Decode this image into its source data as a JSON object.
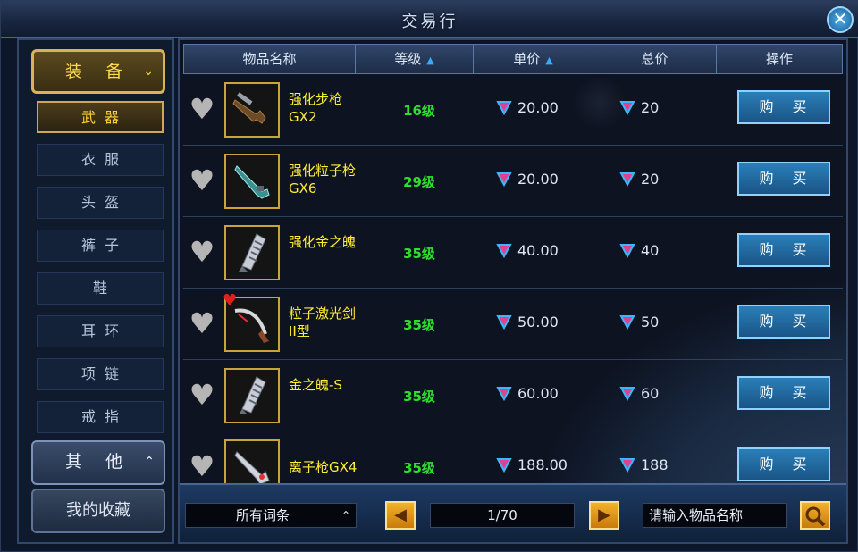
{
  "window": {
    "title": "交易行",
    "close_icon": "close-icon"
  },
  "sidebar": {
    "equipment_label": "装 备",
    "equipment_arrow": "⌄",
    "items": [
      {
        "label": "武器",
        "active": true
      },
      {
        "label": "衣服"
      },
      {
        "label": "头盔"
      },
      {
        "label": "裤子"
      },
      {
        "label": "鞋"
      },
      {
        "label": "耳环"
      },
      {
        "label": "项链"
      },
      {
        "label": "戒指"
      }
    ],
    "other_label": "其 他",
    "other_arrow": "⌃",
    "favorites_label": "我的收藏"
  },
  "table": {
    "headers": {
      "name": "物品名称",
      "level": "等级",
      "unit_price": "单价",
      "total_price": "总价",
      "action": "操作"
    },
    "rows": [
      {
        "name": "强化步枪GX2",
        "level": "16级",
        "unit_price": "20.00",
        "total": "20",
        "buy": "购 买",
        "favorited": false,
        "icon": "rifle-icon"
      },
      {
        "name": "强化粒子枪GX6",
        "level": "29级",
        "unit_price": "20.00",
        "total": "20",
        "buy": "购 买",
        "favorited": false,
        "icon": "particle-gun-icon"
      },
      {
        "name": "强化金之魄",
        "level": "35级",
        "unit_price": "40.00",
        "total": "40",
        "buy": "购 买",
        "favorited": false,
        "icon": "gauntlet-icon"
      },
      {
        "name": "粒子激光剑II型",
        "level": "35级",
        "unit_price": "50.00",
        "total": "50",
        "buy": "购 买",
        "favorited": true,
        "icon": "laser-sword-icon"
      },
      {
        "name": "金之魄-S",
        "level": "35级",
        "unit_price": "60.00",
        "total": "60",
        "buy": "购 买",
        "favorited": false,
        "icon": "gauntlet-icon"
      },
      {
        "name": "离子枪GX4",
        "level": "35级",
        "unit_price": "188.00",
        "total": "188",
        "buy": "购 买",
        "favorited": false,
        "icon": "ion-gun-icon"
      }
    ]
  },
  "footer": {
    "filter_value": "所有词条",
    "page": "1/70",
    "search_placeholder": "请输入物品名称"
  },
  "colors": {
    "level_green": "#2de02d",
    "name_yellow": "#ffee33",
    "gold_border": "#c8a43a"
  }
}
